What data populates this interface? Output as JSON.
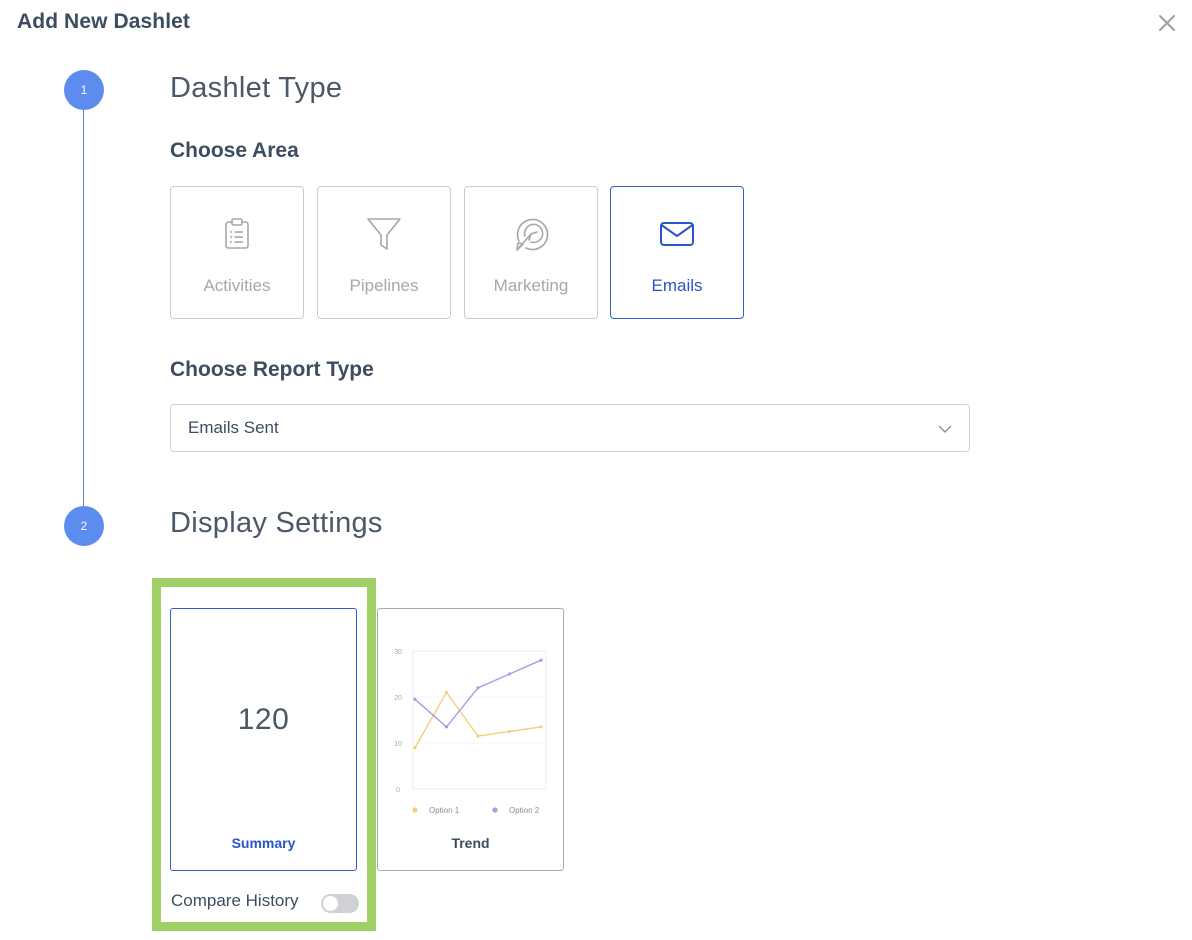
{
  "modal": {
    "title": "Add New Dashlet"
  },
  "steps": [
    {
      "number": "1",
      "title": "Dashlet Type"
    },
    {
      "number": "2",
      "title": "Display Settings"
    }
  ],
  "area": {
    "heading": "Choose Area",
    "options": [
      {
        "label": "Activities",
        "icon": "clipboard-icon",
        "selected": false
      },
      {
        "label": "Pipelines",
        "icon": "funnel-icon",
        "selected": false
      },
      {
        "label": "Marketing",
        "icon": "target-arrow-icon",
        "selected": false
      },
      {
        "label": "Emails",
        "icon": "envelope-icon",
        "selected": true
      }
    ]
  },
  "report_type": {
    "heading": "Choose Report Type",
    "selected_value": "Emails Sent"
  },
  "display": {
    "summary": {
      "value": "120",
      "label": "Summary",
      "selected": true
    },
    "trend": {
      "label": "Trend",
      "chart_data": {
        "type": "line",
        "x": [
          1,
          2,
          3,
          4,
          5
        ],
        "ylim": [
          0,
          30
        ],
        "yticks": [
          "0",
          "10",
          "20",
          "30"
        ],
        "series": [
          {
            "name": "Option 1",
            "color": "#f7cf7a",
            "values": [
              9,
              21,
              11.5,
              12.5,
              13.5
            ]
          },
          {
            "name": "Option 2",
            "color": "#a99be6",
            "values": [
              19.5,
              13.5,
              22,
              25,
              28
            ]
          }
        ],
        "legend": "bottom"
      }
    },
    "compare_history": {
      "label": "Compare History",
      "enabled": false
    }
  },
  "colors": {
    "accent": "#2f5fd0",
    "step": "#5b8cee",
    "highlight": "#9fd065"
  }
}
